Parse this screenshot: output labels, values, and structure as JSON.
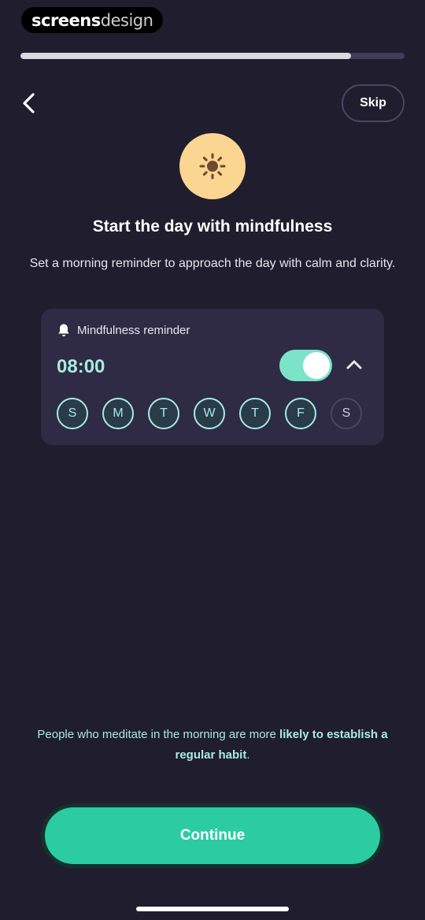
{
  "watermark": {
    "part1": "screens",
    "part2": "design"
  },
  "progress": {
    "fraction": 0.86
  },
  "nav": {
    "back_icon": "chevron-left-icon",
    "skip_label": "Skip"
  },
  "hero": {
    "icon": "sun-icon",
    "icon_bg": "#fbd592",
    "title": "Start the day with mindfulness",
    "subtitle": "Set a morning reminder to approach the day with calm and clarity."
  },
  "reminder": {
    "label": "Mindfulness reminder",
    "icon": "bell-icon",
    "time": "08:00",
    "enabled": true,
    "days": [
      {
        "label": "S",
        "selected": true
      },
      {
        "label": "M",
        "selected": true
      },
      {
        "label": "T",
        "selected": true
      },
      {
        "label": "W",
        "selected": true
      },
      {
        "label": "T",
        "selected": true
      },
      {
        "label": "F",
        "selected": true
      },
      {
        "label": "S",
        "selected": false
      }
    ]
  },
  "tip": {
    "text_before": "People who meditate in the morning are more ",
    "text_bold": "likely to establish a regular habit",
    "text_after": "."
  },
  "cta": {
    "label": "Continue"
  },
  "colors": {
    "accent": "#2bcca2",
    "teal_text": "#a6ece1",
    "background": "#201d2e",
    "card": "#2f2b44"
  }
}
